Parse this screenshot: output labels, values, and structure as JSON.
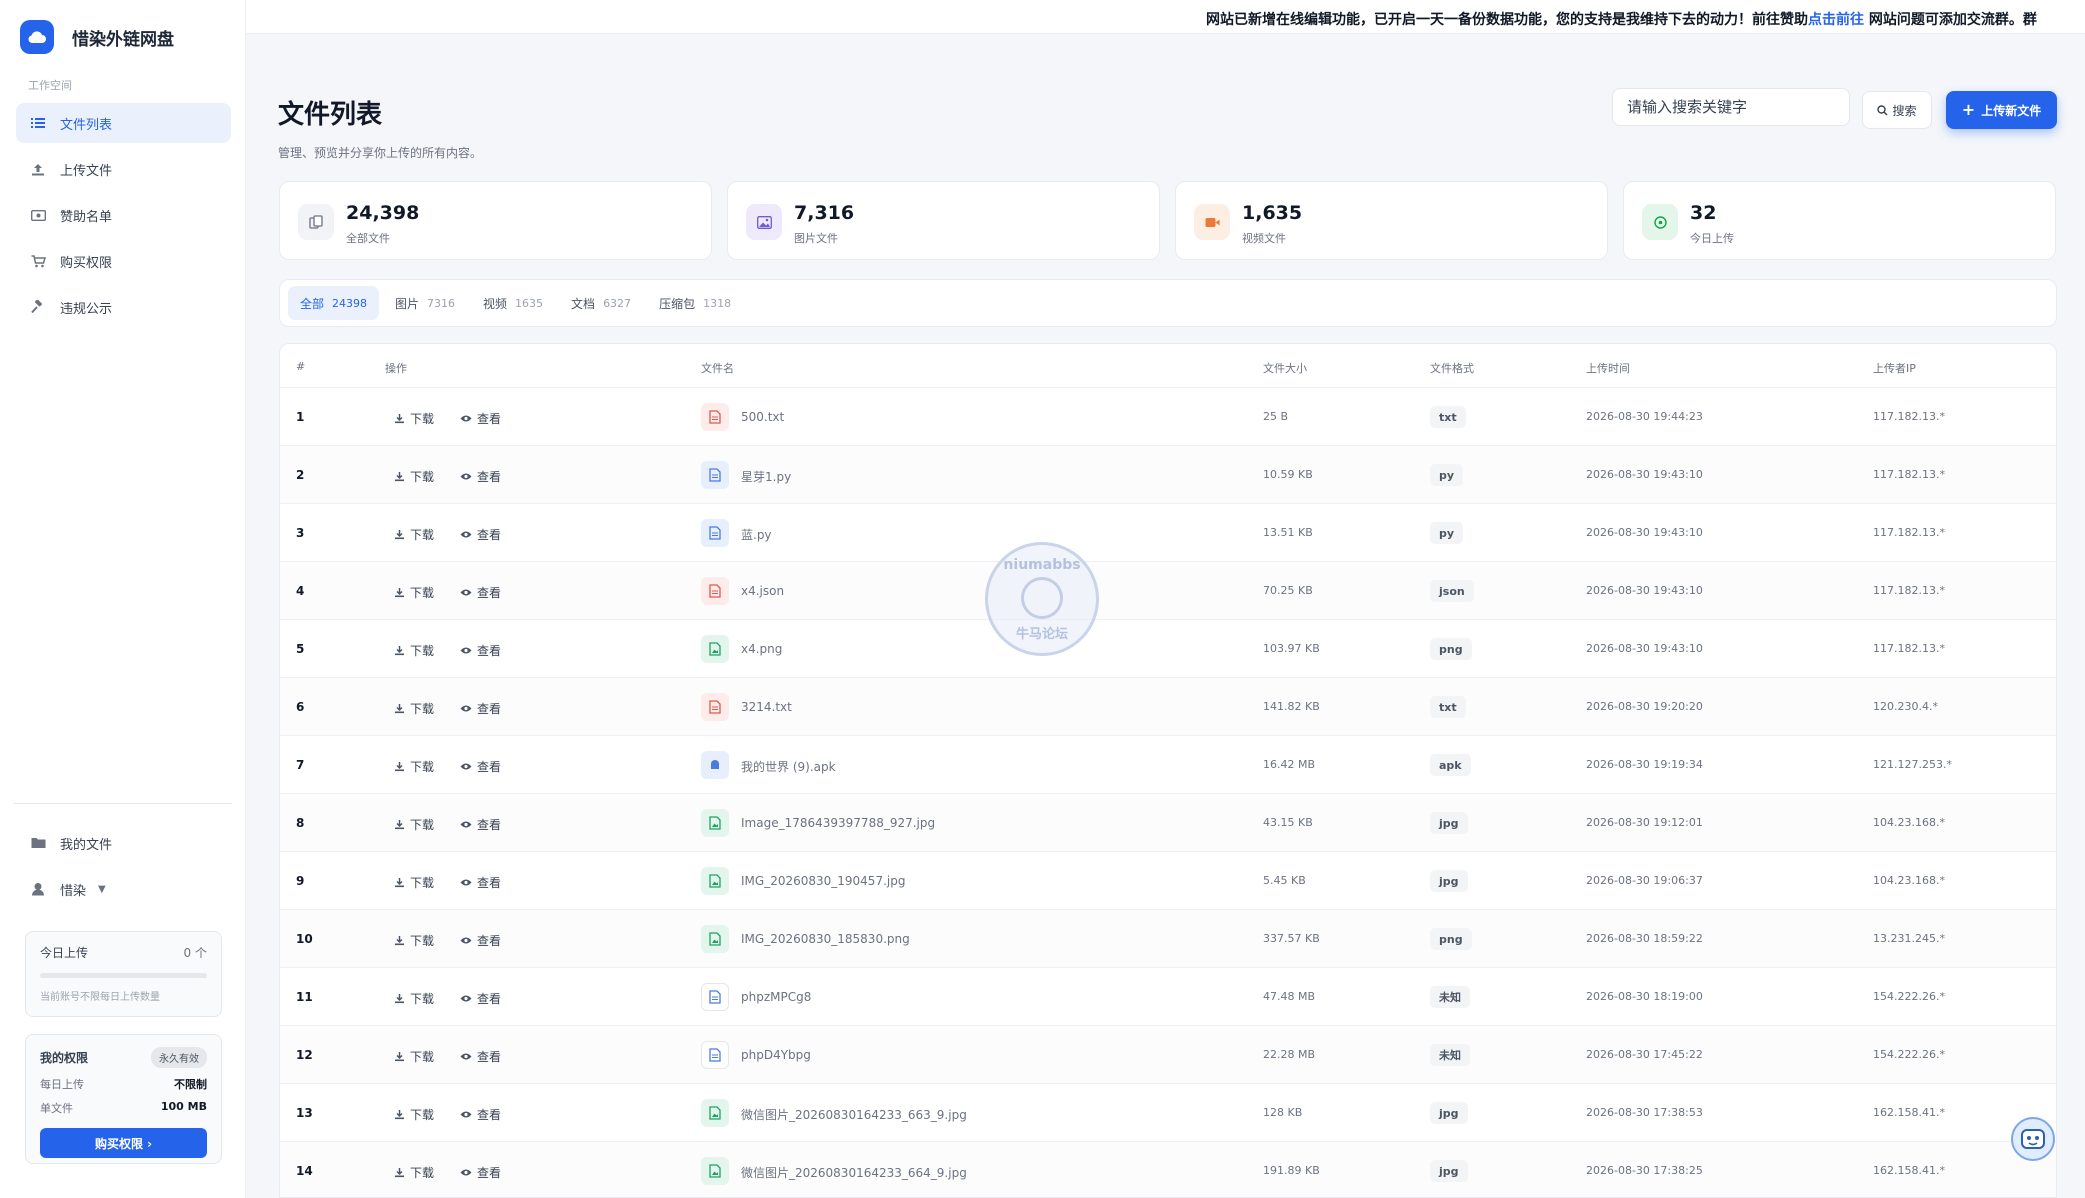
{
  "brand": {
    "title": "惜染外链网盘"
  },
  "sidebar": {
    "section_label": "工作空间",
    "items": [
      {
        "label": "文件列表",
        "icon": "list-icon",
        "active": true
      },
      {
        "label": "上传文件",
        "icon": "upload-icon",
        "active": false
      },
      {
        "label": "赞助名单",
        "icon": "money-icon",
        "active": false
      },
      {
        "label": "购买权限",
        "icon": "cart-icon",
        "active": false
      },
      {
        "label": "违规公示",
        "icon": "gavel-icon",
        "active": false
      }
    ],
    "my_files": "我的文件",
    "user_name": "惜染",
    "today_card": {
      "title": "今日上传",
      "count": "0 个",
      "note": "当前账号不限每日上传数量"
    },
    "perm_card": {
      "title": "我的权限",
      "badge": "永久有效",
      "daily_label": "每日上传",
      "daily_value": "不限制",
      "single_label": "单文件",
      "single_value": "100 MB",
      "buy_button": "购买权限 ›"
    }
  },
  "topbar": {
    "announce_pre": "网站已新增在线编辑功能，已开启一天一备份数据功能，您的支持是我维持下去的动力！前往赞助",
    "announce_link": "点击前往",
    "announce_post": " 网站问题可添加交流群。群"
  },
  "header": {
    "title": "文件列表",
    "subtitle": "管理、预览并分享你上传的所有内容。",
    "search_placeholder": "请输入搜索关键字",
    "search_button": "搜索",
    "upload_button": "上传新文件"
  },
  "stats": [
    {
      "value": "24,398",
      "label": "全部文件",
      "icon": "files-icon",
      "color": "#6b7280",
      "bg": "#f1f3f7"
    },
    {
      "value": "7,316",
      "label": "图片文件",
      "icon": "image-icon",
      "color": "#6d5dd3",
      "bg": "#eeeafc"
    },
    {
      "value": "1,635",
      "label": "视频文件",
      "icon": "video-icon",
      "color": "#ea7a3a",
      "bg": "#fdeee3"
    },
    {
      "value": "32",
      "label": "今日上传",
      "icon": "today-icon",
      "color": "#16a34a",
      "bg": "#e4f6ea"
    }
  ],
  "tabs": [
    {
      "label": "全部",
      "count": "24398",
      "active": true
    },
    {
      "label": "图片",
      "count": "7316",
      "active": false
    },
    {
      "label": "视频",
      "count": "1635",
      "active": false
    },
    {
      "label": "文档",
      "count": "6327",
      "active": false
    },
    {
      "label": "压缩包",
      "count": "1318",
      "active": false
    }
  ],
  "table": {
    "columns": [
      "#",
      "操作",
      "文件名",
      "文件大小",
      "文件格式",
      "上传时间",
      "上传者IP"
    ],
    "download_label": "下载",
    "view_label": "查看",
    "rows": [
      {
        "idx": "1",
        "name": "500.txt",
        "size": "25 B",
        "fmt": "txt",
        "time": "2026-08-30 19:44:23",
        "ip": "117.182.13.*",
        "kind": "doc-red"
      },
      {
        "idx": "2",
        "name": "星芽1.py",
        "size": "10.59 KB",
        "fmt": "py",
        "time": "2026-08-30 19:43:10",
        "ip": "117.182.13.*",
        "kind": "doc-blue"
      },
      {
        "idx": "3",
        "name": "蓝.py",
        "size": "13.51 KB",
        "fmt": "py",
        "time": "2026-08-30 19:43:10",
        "ip": "117.182.13.*",
        "kind": "doc-blue"
      },
      {
        "idx": "4",
        "name": "x4.json",
        "size": "70.25 KB",
        "fmt": "json",
        "time": "2026-08-30 19:43:10",
        "ip": "117.182.13.*",
        "kind": "doc-red"
      },
      {
        "idx": "5",
        "name": "x4.png",
        "size": "103.97 KB",
        "fmt": "png",
        "time": "2026-08-30 19:43:10",
        "ip": "117.182.13.*",
        "kind": "img-green"
      },
      {
        "idx": "6",
        "name": "3214.txt",
        "size": "141.82 KB",
        "fmt": "txt",
        "time": "2026-08-30 19:20:20",
        "ip": "120.230.4.*",
        "kind": "doc-red"
      },
      {
        "idx": "7",
        "name": "我的世界 (9).apk",
        "size": "16.42 MB",
        "fmt": "apk",
        "time": "2026-08-30 19:19:34",
        "ip": "121.127.253.*",
        "kind": "apk-blue"
      },
      {
        "idx": "8",
        "name": "Image_1786439397788_927.jpg",
        "size": "43.15 KB",
        "fmt": "jpg",
        "time": "2026-08-30 19:12:01",
        "ip": "104.23.168.*",
        "kind": "img-green"
      },
      {
        "idx": "9",
        "name": "IMG_20260830_190457.jpg",
        "size": "5.45 KB",
        "fmt": "jpg",
        "time": "2026-08-30 19:06:37",
        "ip": "104.23.168.*",
        "kind": "img-green"
      },
      {
        "idx": "10",
        "name": "IMG_20260830_185830.png",
        "size": "337.57 KB",
        "fmt": "png",
        "time": "2026-08-30 18:59:22",
        "ip": "13.231.245.*",
        "kind": "img-green"
      },
      {
        "idx": "11",
        "name": "phpzMPCg8",
        "size": "47.48 MB",
        "fmt": "未知",
        "time": "2026-08-30 18:19:00",
        "ip": "154.222.26.*",
        "kind": "file-blue"
      },
      {
        "idx": "12",
        "name": "phpD4Ybpg",
        "size": "22.28 MB",
        "fmt": "未知",
        "time": "2026-08-30 17:45:22",
        "ip": "154.222.26.*",
        "kind": "file-blue"
      },
      {
        "idx": "13",
        "name": "微信图片_20260830164233_663_9.jpg",
        "size": "128 KB",
        "fmt": "jpg",
        "time": "2026-08-30 17:38:53",
        "ip": "162.158.41.*",
        "kind": "img-green"
      },
      {
        "idx": "14",
        "name": "微信图片_20260830164233_664_9.jpg",
        "size": "191.89 KB",
        "fmt": "jpg",
        "time": "2026-08-30 17:38:25",
        "ip": "162.158.41.*",
        "kind": "img-green"
      }
    ]
  },
  "watermark": {
    "top": "niumabbs",
    "bottom": "牛马论坛"
  },
  "colors": {
    "accent": "#2563eb",
    "doc_red": "#e2574c",
    "img_green": "#1fa363",
    "doc_blue": "#4a7be0"
  }
}
